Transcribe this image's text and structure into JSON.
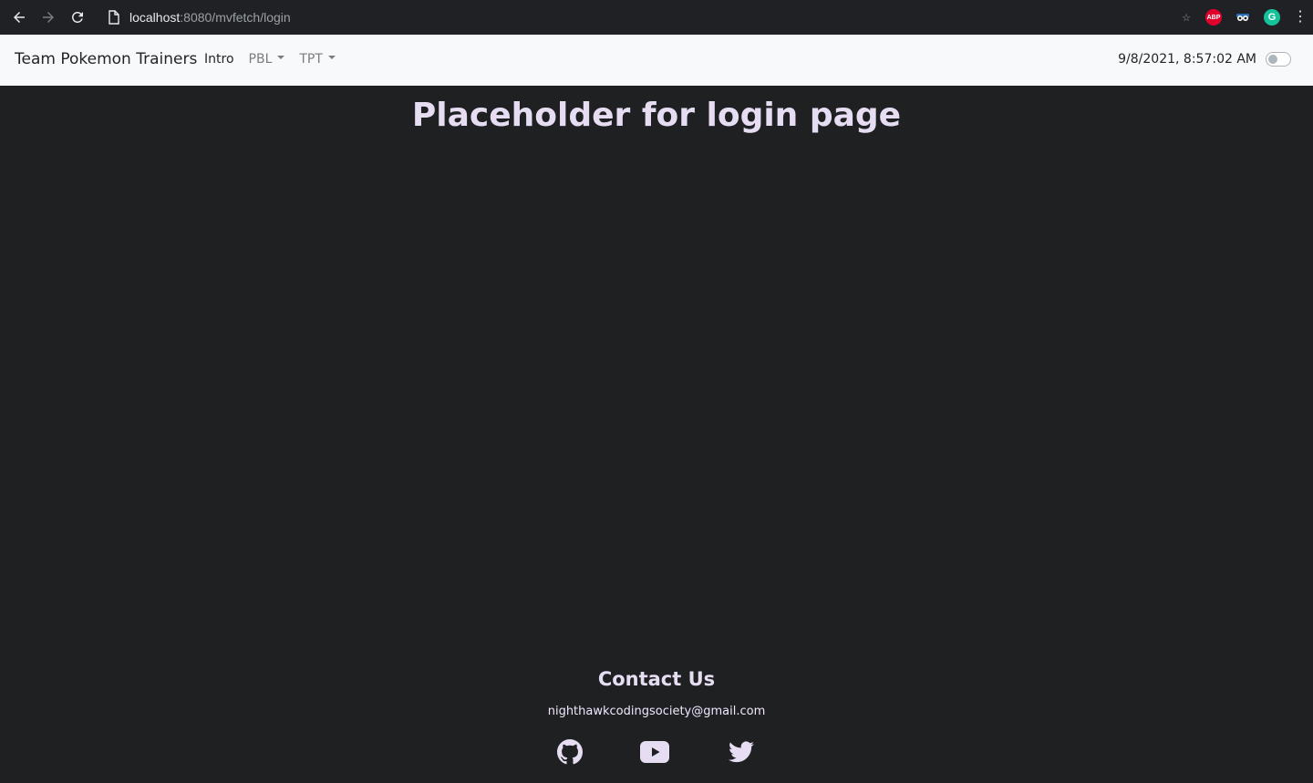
{
  "browser": {
    "url_host": "localhost",
    "url_path": ":8080/mvfetch/login",
    "extensions": [
      {
        "name": "bookmark-star-icon",
        "glyph": "☆"
      },
      {
        "name": "adblock-plus-icon",
        "text": "ABP",
        "color": "#e0002b"
      },
      {
        "name": "eyes-extension-icon"
      },
      {
        "name": "grammarly-icon",
        "text": "G",
        "color": "#15c39a"
      },
      {
        "name": "kebab-menu-icon",
        "glyph": "⋮"
      }
    ]
  },
  "navbar": {
    "brand": "Team Pokemon Trainers",
    "links": {
      "intro": "Intro",
      "pbl": "PBL",
      "tpt": "TPT"
    },
    "datetime": "9/8/2021, 8:57:02 AM",
    "theme_toggle_on": false
  },
  "main": {
    "title": "Placeholder for login page"
  },
  "footer": {
    "heading": "Contact Us",
    "email": "nighthawkcodingsociety@gmail.com",
    "social_icons": [
      "github-icon",
      "youtube-icon",
      "twitter-icon"
    ]
  },
  "colors": {
    "page_bg": "#1f2021",
    "navbar_bg": "#f8f9fa",
    "heading_text": "#e6ddf3",
    "browser_bar": "#202124"
  }
}
